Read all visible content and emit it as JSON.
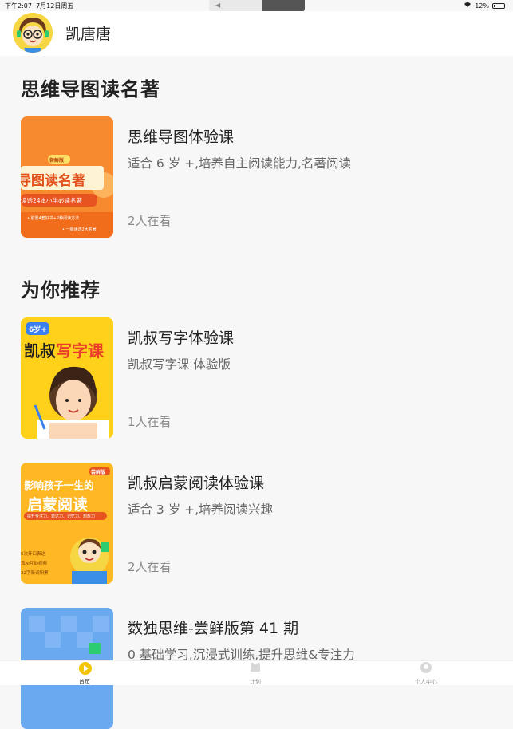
{
  "status_bar": {
    "time": "下午2:07",
    "date": "7月12日周五",
    "battery": "12%",
    "battery_level": 0.12
  },
  "volume_hud": {
    "level": 0.45
  },
  "header": {
    "username": "凯唐唐"
  },
  "sections": [
    {
      "title": "思维导图读名著",
      "cards": [
        {
          "title": "思维导图体验课",
          "desc": "适合 6 岁 +,培养自主阅读能力,名著阅读",
          "watching": "2人在看",
          "thumb": {
            "badge": "尝鲜版",
            "line1": "导图读名著",
            "line2": "读透24本小学必读名著",
            "line3": "• 前置4套好书+2种阅读方法",
            "line4": "• 一图读透2大名著"
          }
        }
      ]
    },
    {
      "title": "为你推荐",
      "cards": [
        {
          "title": "凯叔写字体验课",
          "desc": "凯叔写字课 体验版",
          "watching": "1人在看",
          "thumb": {
            "badge": "6岁+",
            "line1": "凯叔",
            "line2": "写字课"
          }
        },
        {
          "title": "凯叔启蒙阅读体验课",
          "desc": "适合 3 岁 +,培养阅读兴趣",
          "watching": "2人在看",
          "thumb": {
            "badge": "尝鲜版",
            "line1": "影响孩子一生的",
            "line2": "启蒙阅读",
            "line3": "提升专注力、表达力、记忆力、想象力",
            "line4": "5次开口表达",
            "line5": "真AI互动视频",
            "line6": "32字新词积累"
          }
        },
        {
          "title": "数独思维-尝鲜版第 41 期",
          "desc": "0 基础学习,沉浸式训练,提升思维&专注力",
          "watching": ""
        }
      ]
    }
  ],
  "tabbar": [
    {
      "label": "首页",
      "active": true
    },
    {
      "label": "计划",
      "active": false
    },
    {
      "label": "个人中心",
      "active": false
    }
  ],
  "colors": {
    "accent": "#f5c400",
    "orange": "#f57a22",
    "yellow": "#ffd11a",
    "blue": "#6aa8ef"
  }
}
